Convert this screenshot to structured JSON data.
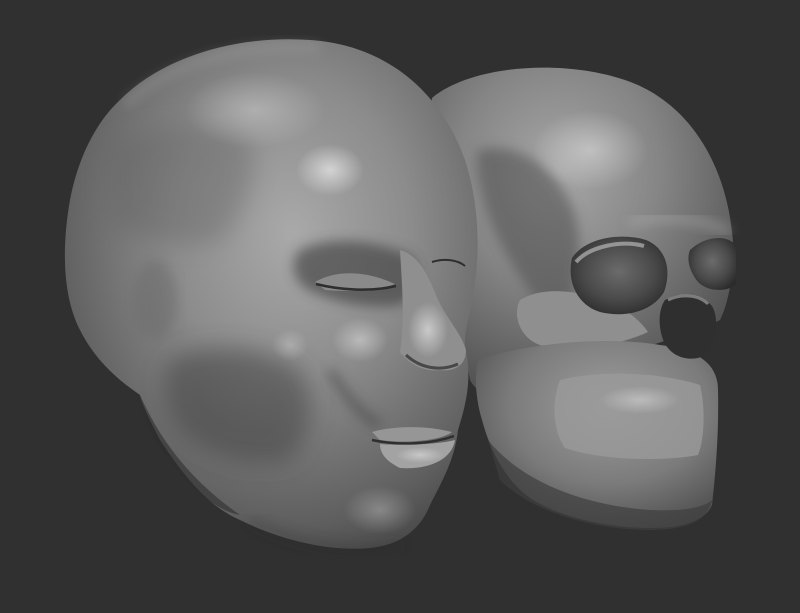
{
  "viewport": {
    "background_color": "#303030"
  },
  "scene": {
    "objects": [
      {
        "name": "sculpted-head",
        "material_color": "#7a7a7a"
      },
      {
        "name": "sculpted-skull",
        "material_color": "#7c7c7c"
      }
    ]
  }
}
